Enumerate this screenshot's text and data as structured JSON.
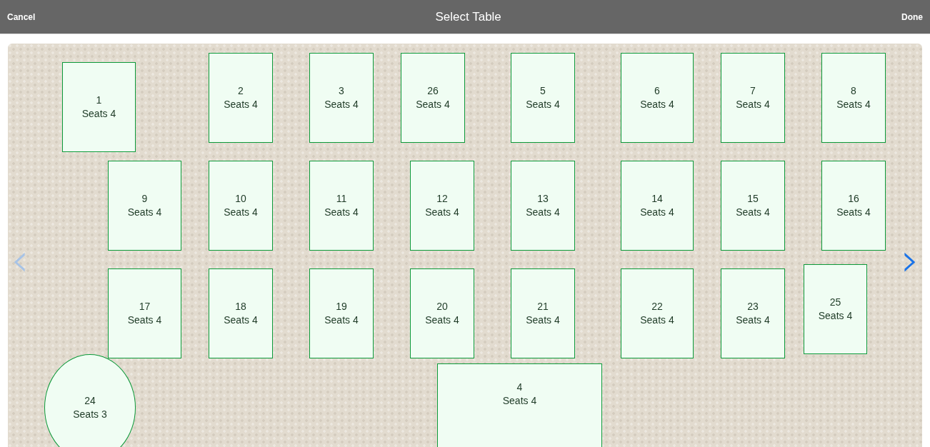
{
  "header": {
    "cancel": "Cancel",
    "title": "Select Table",
    "done": "Done"
  },
  "nav": {
    "previous": {
      "label": "‹",
      "disabled": true
    },
    "next": {
      "label": "›",
      "disabled": false
    }
  },
  "tables": [
    {
      "kind": "rect",
      "number": "1",
      "seats": "Seats 4"
    },
    {
      "kind": "rect",
      "number": "2",
      "seats": "Seats 4"
    },
    {
      "kind": "rect",
      "number": "3",
      "seats": "Seats 4"
    },
    {
      "kind": "rect",
      "number": "26",
      "seats": "Seats 4"
    },
    {
      "kind": "rect",
      "number": "5",
      "seats": "Seats 4"
    },
    {
      "kind": "rect",
      "number": "6",
      "seats": "Seats 4"
    },
    {
      "kind": "rect",
      "number": "7",
      "seats": "Seats 4"
    },
    {
      "kind": "rect",
      "number": "8",
      "seats": "Seats 4"
    },
    {
      "kind": "rect",
      "number": "9",
      "seats": "Seats 4"
    },
    {
      "kind": "rect",
      "number": "10",
      "seats": "Seats 4"
    },
    {
      "kind": "rect",
      "number": "11",
      "seats": "Seats 4"
    },
    {
      "kind": "rect",
      "number": "12",
      "seats": "Seats 4"
    },
    {
      "kind": "rect",
      "number": "13",
      "seats": "Seats 4"
    },
    {
      "kind": "rect",
      "number": "14",
      "seats": "Seats 4"
    },
    {
      "kind": "rect",
      "number": "15",
      "seats": "Seats 4"
    },
    {
      "kind": "rect",
      "number": "16",
      "seats": "Seats 4"
    },
    {
      "kind": "rect",
      "number": "17",
      "seats": "Seats 4"
    },
    {
      "kind": "rect",
      "number": "18",
      "seats": "Seats 4"
    },
    {
      "kind": "rect",
      "number": "19",
      "seats": "Seats 4"
    },
    {
      "kind": "rect",
      "number": "20",
      "seats": "Seats 4"
    },
    {
      "kind": "rect",
      "number": "21",
      "seats": "Seats 4"
    },
    {
      "kind": "rect",
      "number": "22",
      "seats": "Seats 4"
    },
    {
      "kind": "rect",
      "number": "23",
      "seats": "Seats 4"
    },
    {
      "kind": "rect",
      "number": "25",
      "seats": "Seats 4"
    },
    {
      "kind": "round",
      "number": "24",
      "seats": "Seats 3"
    },
    {
      "kind": "rect",
      "number": "4",
      "seats": "Seats 4"
    }
  ]
}
